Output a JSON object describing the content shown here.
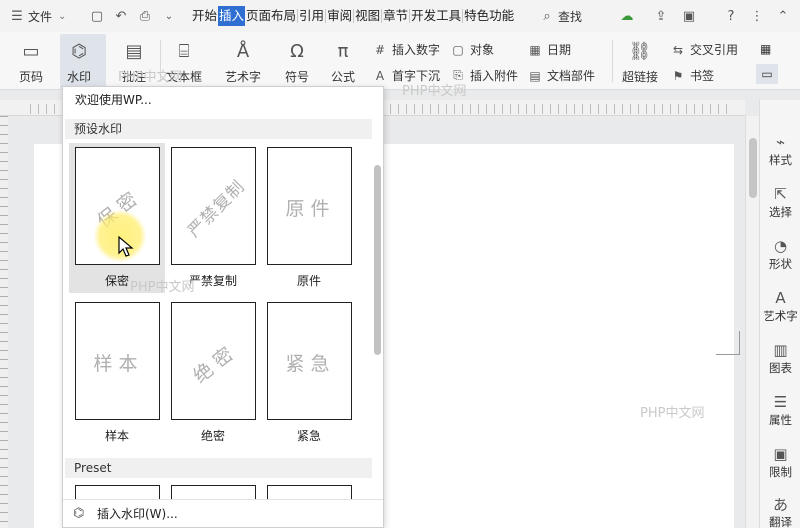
{
  "menubar": {
    "file_label": "文件",
    "tabs": [
      "开始",
      "插入",
      "页面布局",
      "引用",
      "审阅",
      "视图",
      "章节",
      "开发工具",
      "特色功能"
    ],
    "active_tab": "插入",
    "search_label": "查找"
  },
  "ribbon": {
    "page_number": "页码",
    "watermark": "水印",
    "comment": "批注",
    "textbox": "文本框",
    "wordart": "艺术字",
    "symbol": "符号",
    "formula": "公式",
    "insert_number": "插入数字",
    "object": "对象",
    "date": "日期",
    "dropcap": "首字下沉",
    "insert_attachment": "插入附件",
    "doc_parts": "文档部件",
    "hyperlink": "超链接",
    "cross_reference": "交叉引用",
    "bookmark": "书签"
  },
  "dropdown": {
    "welcome": "欢迎使用WP...",
    "preset_section": "预设水印",
    "preset_section_en": "Preset",
    "items": [
      {
        "label": "保密",
        "text": "保密"
      },
      {
        "label": "严禁复制",
        "text": "严禁复制"
      },
      {
        "label": "原件",
        "text": "原件"
      },
      {
        "label": "样本",
        "text": "样本"
      },
      {
        "label": "绝密",
        "text": "绝密"
      },
      {
        "label": "紧急",
        "text": "紧急"
      }
    ],
    "insert_watermark": "插入水印(W)..."
  },
  "sidebar": {
    "items": [
      "样式",
      "选择",
      "形状",
      "艺术字",
      "图表",
      "属性",
      "限制",
      "翻译"
    ]
  },
  "overlay": {
    "watermark_text": "PHP中文网"
  }
}
